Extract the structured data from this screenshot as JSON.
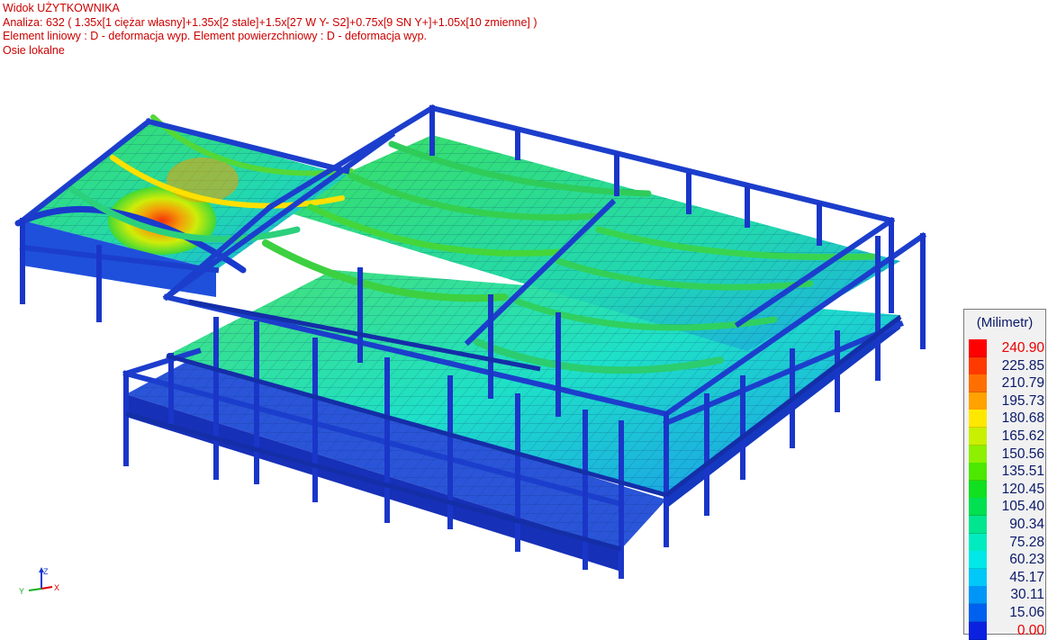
{
  "header": {
    "view_title": "Widok UŻYTKOWNIKA",
    "analysis": "Analiza: 632  ( 1.35x[1 ciężar własny]+1.35x[2 stale]+1.5x[27 W Y- S2]+0.75x[9 SN Y+]+1.05x[10 zmienne] )",
    "elements": "Element liniowy  : D - deformacja wyp. Element powierzchniowy  : D - deformacja wyp.",
    "axes_mode": "Osie lokalne"
  },
  "legend": {
    "unit": "(Milimetr)",
    "entries": [
      {
        "value": "240.90",
        "color": "#ff0000",
        "extreme": true
      },
      {
        "value": "225.85",
        "color": "#ff3a00"
      },
      {
        "value": "210.79",
        "color": "#ff6e00"
      },
      {
        "value": "195.73",
        "color": "#ffa200"
      },
      {
        "value": "180.68",
        "color": "#ffe800"
      },
      {
        "value": "165.62",
        "color": "#c8f000"
      },
      {
        "value": "150.56",
        "color": "#8cf000"
      },
      {
        "value": "135.51",
        "color": "#4ce800"
      },
      {
        "value": "120.45",
        "color": "#10e020"
      },
      {
        "value": "105.40",
        "color": "#00e050"
      },
      {
        "value": "90.34",
        "color": "#00e590"
      },
      {
        "value": "75.28",
        "color": "#00ecc0"
      },
      {
        "value": "60.23",
        "color": "#00e8e8"
      },
      {
        "value": "45.17",
        "color": "#00c8f8"
      },
      {
        "value": "30.11",
        "color": "#0096f8"
      },
      {
        "value": "15.06",
        "color": "#0060f0"
      },
      {
        "value": "0.00",
        "color": "#0a22e0",
        "extreme": true
      }
    ]
  },
  "axes": {
    "z": "Z",
    "y": "Y",
    "x": "X"
  },
  "colors": {
    "frame": "#1c3ecc",
    "frame_dark": "#0c1e8a",
    "slab_low": "#1f56e6",
    "slab_mid": "#1ed6a6",
    "beam_green": "#3ccf36",
    "peak": "#ff2a00"
  }
}
